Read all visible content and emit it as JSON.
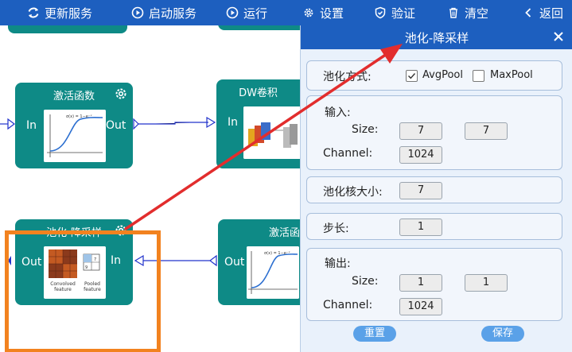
{
  "toolbar": {
    "items": [
      {
        "label": "更新服务",
        "icon": "refresh-icon"
      },
      {
        "label": "启动服务",
        "icon": "play-circle-icon"
      },
      {
        "label": "运行",
        "icon": "run-icon"
      },
      {
        "label": "设置",
        "icon": "gear-icon"
      },
      {
        "label": "验证",
        "icon": "shield-icon"
      },
      {
        "label": "清空",
        "icon": "trash-icon"
      },
      {
        "label": "返回",
        "icon": "chevron-left-icon"
      }
    ]
  },
  "canvas": {
    "nodes": {
      "activation_top": {
        "title": "激活函数",
        "in_label": "In",
        "out_label": "Out"
      },
      "dw_conv": {
        "title": "DW卷积",
        "in_label": "In"
      },
      "pooling": {
        "title": "池化-降采样",
        "in_label": "In",
        "out_label": "Out",
        "thumb_left": "Convolved feature",
        "thumb_right": "Pooled feature"
      },
      "activation_bottom": {
        "title": "激活函数",
        "out_label": "Out"
      }
    }
  },
  "panel": {
    "title": "池化-降采样",
    "pool_mode": {
      "label": "池化方式:",
      "avg": "AvgPool",
      "max": "MaxPool",
      "avg_checked": true,
      "max_checked": false
    },
    "input": {
      "heading": "输入:",
      "size_label": "Size:",
      "size_w": "7",
      "size_h": "7",
      "channel_label": "Channel:",
      "channel": "1024"
    },
    "kernel": {
      "label": "池化核大小:",
      "value": "7"
    },
    "stride": {
      "label": "步长:",
      "value": "1"
    },
    "output": {
      "heading": "输出:",
      "size_label": "Size:",
      "size_w": "1",
      "size_h": "1",
      "channel_label": "Channel:",
      "channel": "1024"
    },
    "reset_label": "重置",
    "save_label": "保存"
  },
  "colors": {
    "toolbar": "#1d5fbf",
    "node": "#0e8a86",
    "highlight": "#f2821f",
    "arrow": "#e22d2d"
  }
}
